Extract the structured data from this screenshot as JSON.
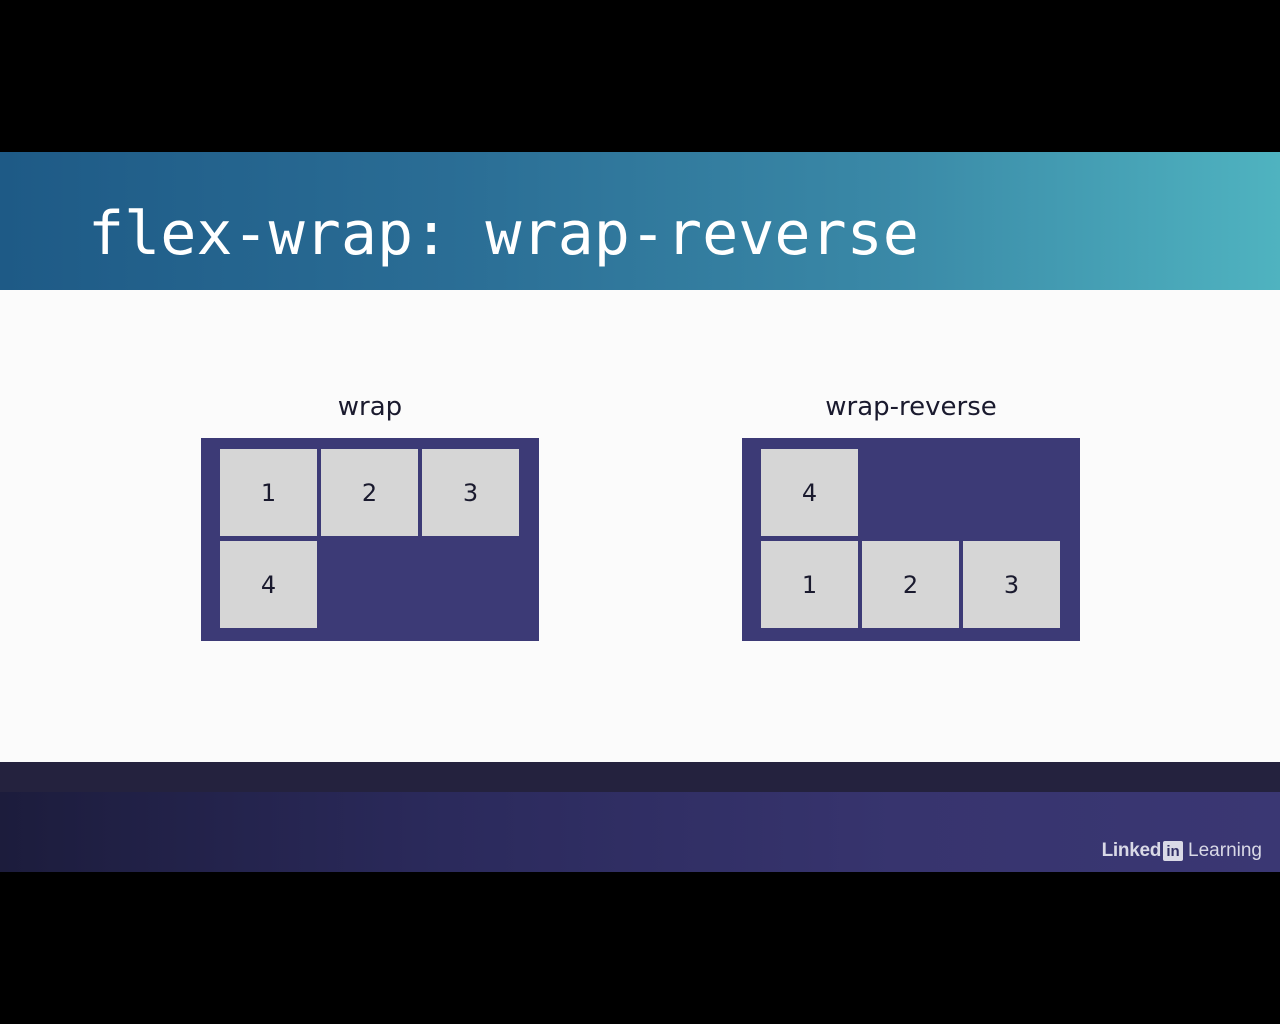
{
  "slide": {
    "title": "flex-wrap: wrap-reverse"
  },
  "demos": {
    "wrap": {
      "label": "wrap",
      "items": [
        "1",
        "2",
        "3",
        "4"
      ]
    },
    "wrap_reverse": {
      "label": "wrap-reverse",
      "items": [
        "1",
        "2",
        "3",
        "4"
      ]
    }
  },
  "branding": {
    "linked": "Linked",
    "in": "in",
    "learning": "Learning"
  },
  "colors": {
    "container": "#3c3a76",
    "item": "#d6d6d6",
    "title_text": "#ffffff"
  }
}
